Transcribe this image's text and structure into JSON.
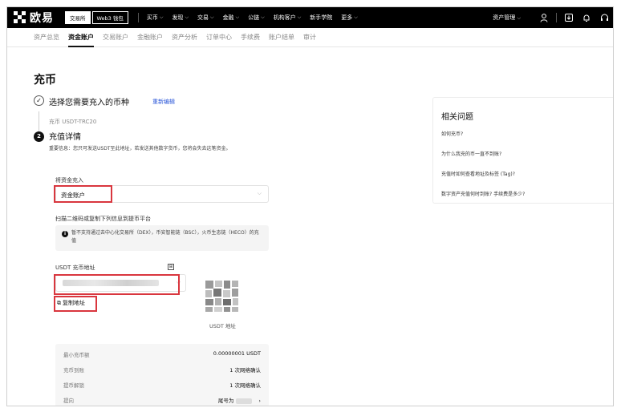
{
  "topnav": {
    "logo": "欧易",
    "toggle": [
      "交易所",
      "Web3 钱包"
    ],
    "menu": [
      {
        "label": "买币",
        "chevron": true
      },
      {
        "label": "发现",
        "chevron": true
      },
      {
        "label": "交易",
        "chevron": true
      },
      {
        "label": "金融",
        "chevron": true
      },
      {
        "label": "公链",
        "chevron": true
      },
      {
        "label": "机构客户",
        "chevron": true
      },
      {
        "label": "新手学院",
        "chevron": false
      },
      {
        "label": "更多",
        "chevron": true
      }
    ],
    "asset_menu": "资产管理",
    "icons": [
      "user-icon",
      "download-icon",
      "bell-icon",
      "headset-icon"
    ]
  },
  "subtabs": [
    "资产总览",
    "资金账户",
    "交易账户",
    "金融账户",
    "资产分析",
    "订单中心",
    "手续费",
    "账户结单",
    "审计"
  ],
  "subtabs_active": 1,
  "page_title": "充币",
  "step1": {
    "number": "✓",
    "title": "选择您需要充入的币种",
    "reedit": "重新编辑",
    "selected": "充币 USDT-TRC20"
  },
  "step2": {
    "number": "2",
    "title": "充值详情",
    "notice": "重要信息：您只可发送USDT至此地址，若发送其他数字货币，您将会失去这笔资金。"
  },
  "deposit_to": {
    "label": "将资金充入",
    "value": "资金账户"
  },
  "scan_label": "扫描二维码或复制下列信息到提币平台",
  "info": {
    "icon": "i",
    "text": "暂不支持通过去中心化交易所（DEX），币安智能链（BSC），火币生态链（HECO）的充值"
  },
  "address": {
    "label": "USDT 充币地址",
    "copy_label": "复制地址",
    "qr_caption": "USDT 地址"
  },
  "summary": [
    {
      "key": "最小充币额",
      "value": "0.00000001 USDT"
    },
    {
      "key": "充币到账",
      "value": "1 次网络确认"
    },
    {
      "key": "提币解锁",
      "value": "1 次网络确认"
    },
    {
      "key": "提向",
      "value": "尾号为"
    }
  ],
  "side": {
    "title": "相关问题",
    "links": [
      "如何充币?",
      "为什么我充的币一直不到账?",
      "充值时如何查看地址及标签 (Tag)?",
      "数字资产充值何时到账? 手续费是多少?"
    ]
  },
  "colors": {
    "highlight": "#d9363e",
    "link": "#2b57d8",
    "nav_bg": "#000000"
  }
}
